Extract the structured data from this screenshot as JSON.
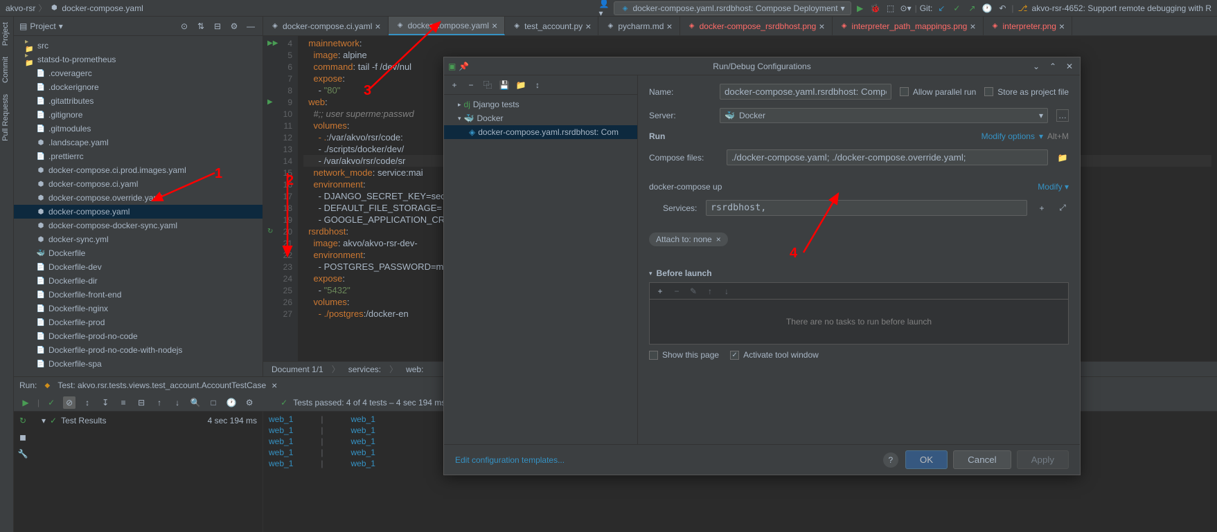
{
  "breadcrumb": {
    "root": "akvo-rsr",
    "file": "docker-compose.yaml"
  },
  "top": {
    "run_config": "docker-compose.yaml.rsrdbhost: Compose Deployment",
    "git_label": "Git:",
    "right_tag": "akvo-rsr-4652: Support remote debugging with R"
  },
  "project": {
    "title": "Project",
    "items": [
      {
        "label": "src",
        "type": "folder-closed"
      },
      {
        "label": "statsd-to-prometheus",
        "type": "folder"
      },
      {
        "label": ".coveragerc",
        "type": "file"
      },
      {
        "label": ".dockerignore",
        "type": "file"
      },
      {
        "label": ".gitattributes",
        "type": "file"
      },
      {
        "label": ".gitignore",
        "type": "file"
      },
      {
        "label": ".gitmodules",
        "type": "file"
      },
      {
        "label": ".landscape.yaml",
        "type": "yaml"
      },
      {
        "label": ".prettierrc",
        "type": "file"
      },
      {
        "label": "docker-compose.ci.prod.images.yaml",
        "type": "yaml"
      },
      {
        "label": "docker-compose.ci.yaml",
        "type": "yaml"
      },
      {
        "label": "docker-compose.override.yaml",
        "type": "yaml"
      },
      {
        "label": "docker-compose.yaml",
        "type": "yaml",
        "selected": true
      },
      {
        "label": "docker-compose-docker-sync.yaml",
        "type": "yaml"
      },
      {
        "label": "docker-sync.yml",
        "type": "yaml-red"
      },
      {
        "label": "Dockerfile",
        "type": "docker"
      },
      {
        "label": "Dockerfile-dev",
        "type": "file"
      },
      {
        "label": "Dockerfile-dir",
        "type": "file"
      },
      {
        "label": "Dockerfile-front-end",
        "type": "file"
      },
      {
        "label": "Dockerfile-nginx",
        "type": "file"
      },
      {
        "label": "Dockerfile-prod",
        "type": "file"
      },
      {
        "label": "Dockerfile-prod-no-code",
        "type": "file"
      },
      {
        "label": "Dockerfile-prod-no-code-with-nodejs",
        "type": "file"
      },
      {
        "label": "Dockerfile-spa",
        "type": "file"
      }
    ]
  },
  "tabs": [
    {
      "label": "docker-compose.ci.yaml",
      "icon": "yaml"
    },
    {
      "label": "docker-compose.yaml",
      "icon": "yaml",
      "active": true
    },
    {
      "label": "test_account.py",
      "icon": "py"
    },
    {
      "label": "pycharm.md",
      "icon": "md"
    },
    {
      "label": "docker-compose_rsrdbhost.png",
      "icon": "img",
      "highlighted": true
    },
    {
      "label": "interpreter_path_mappings.png",
      "icon": "img",
      "highlighted": true
    },
    {
      "label": "interpreter.png",
      "icon": "img",
      "highlighted": true
    }
  ],
  "code": {
    "lines": [
      {
        "n": 4,
        "text": "  mainnetwork:",
        "gutter": "run"
      },
      {
        "n": 5,
        "text": "    image: alpine"
      },
      {
        "n": 6,
        "text": "    command: tail -f /dev/nul"
      },
      {
        "n": 7,
        "text": "    expose:"
      },
      {
        "n": 8,
        "text": "      - \"80\""
      },
      {
        "n": 9,
        "text": "  web:",
        "gutter": "play"
      },
      {
        "n": 10,
        "text": "    #;; user superme:passwd"
      },
      {
        "n": 11,
        "text": "    volumes:"
      },
      {
        "n": 12,
        "text": "      - .:/var/akvo/rsr/code:"
      },
      {
        "n": 13,
        "text": "      - ./scripts/docker/dev/"
      },
      {
        "n": 14,
        "text": "      - /var/akvo/rsr/code/sr",
        "hl": true
      },
      {
        "n": 15,
        "text": "    network_mode: service:mai"
      },
      {
        "n": 16,
        "text": "    environment:"
      },
      {
        "n": 17,
        "text": "      - DJANGO_SECRET_KEY=sec"
      },
      {
        "n": 18,
        "text": "      - DEFAULT_FILE_STORAGE="
      },
      {
        "n": 19,
        "text": "      - GOOGLE_APPLICATION_CR"
      },
      {
        "n": 20,
        "text": "  rsrdbhost:",
        "gutter": "rerun"
      },
      {
        "n": 21,
        "text": "    image: akvo/akvo-rsr-dev-"
      },
      {
        "n": 22,
        "text": "    environment:"
      },
      {
        "n": 23,
        "text": "      - POSTGRES_PASSWORD=mys"
      },
      {
        "n": 24,
        "text": "    expose:"
      },
      {
        "n": 25,
        "text": "      - \"5432\""
      },
      {
        "n": 26,
        "text": "    volumes:"
      },
      {
        "n": 27,
        "text": "      - ./postgres:/docker-en"
      }
    ],
    "status": {
      "doc": "Document 1/1",
      "path1": "services:",
      "path2": "web:"
    }
  },
  "run": {
    "label": "Run:",
    "tab": "Test: akvo.rsr.tests.views.test_account.AccountTestCase",
    "pass_text": "Tests passed: 4 of 4 tests – 4 sec 194 ms",
    "results_label": "Test Results",
    "results_time": "4 sec 194 ms",
    "log_left": "web_1",
    "log_right": "web_1"
  },
  "dialog": {
    "title": "Run/Debug Configurations",
    "tree": {
      "django": "Django tests",
      "docker": "Docker",
      "item": "docker-compose.yaml.rsrdbhost: Com"
    },
    "form": {
      "name_label": "Name:",
      "name_value": "docker-compose.yaml.rsrdbhost: Compose D",
      "allow_parallel": "Allow parallel run",
      "store_project": "Store as project file",
      "server_label": "Server:",
      "server_value": "Docker",
      "run_section": "Run",
      "modify_options": "Modify options",
      "modify_shortcut": "Alt+M",
      "compose_files_label": "Compose files:",
      "compose_files_value": "./docker-compose.yaml; ./docker-compose.override.yaml;",
      "up_label": "docker-compose up",
      "modify": "Modify",
      "services_label": "Services:",
      "services_value": "rsrdbhost,",
      "attach_to": "Attach to: none",
      "before_launch": "Before launch",
      "no_tasks": "There are no tasks to run before launch",
      "show_page": "Show this page",
      "activate_tool": "Activate tool window"
    },
    "footer": {
      "edit_templates": "Edit configuration templates...",
      "ok": "OK",
      "cancel": "Cancel",
      "apply": "Apply"
    }
  },
  "annotations": {
    "a1": "1",
    "a2": "2",
    "a3": "3",
    "a4": "4"
  },
  "left_tabs": {
    "project": "Project",
    "commit": "Commit",
    "pr": "Pull Requests"
  }
}
